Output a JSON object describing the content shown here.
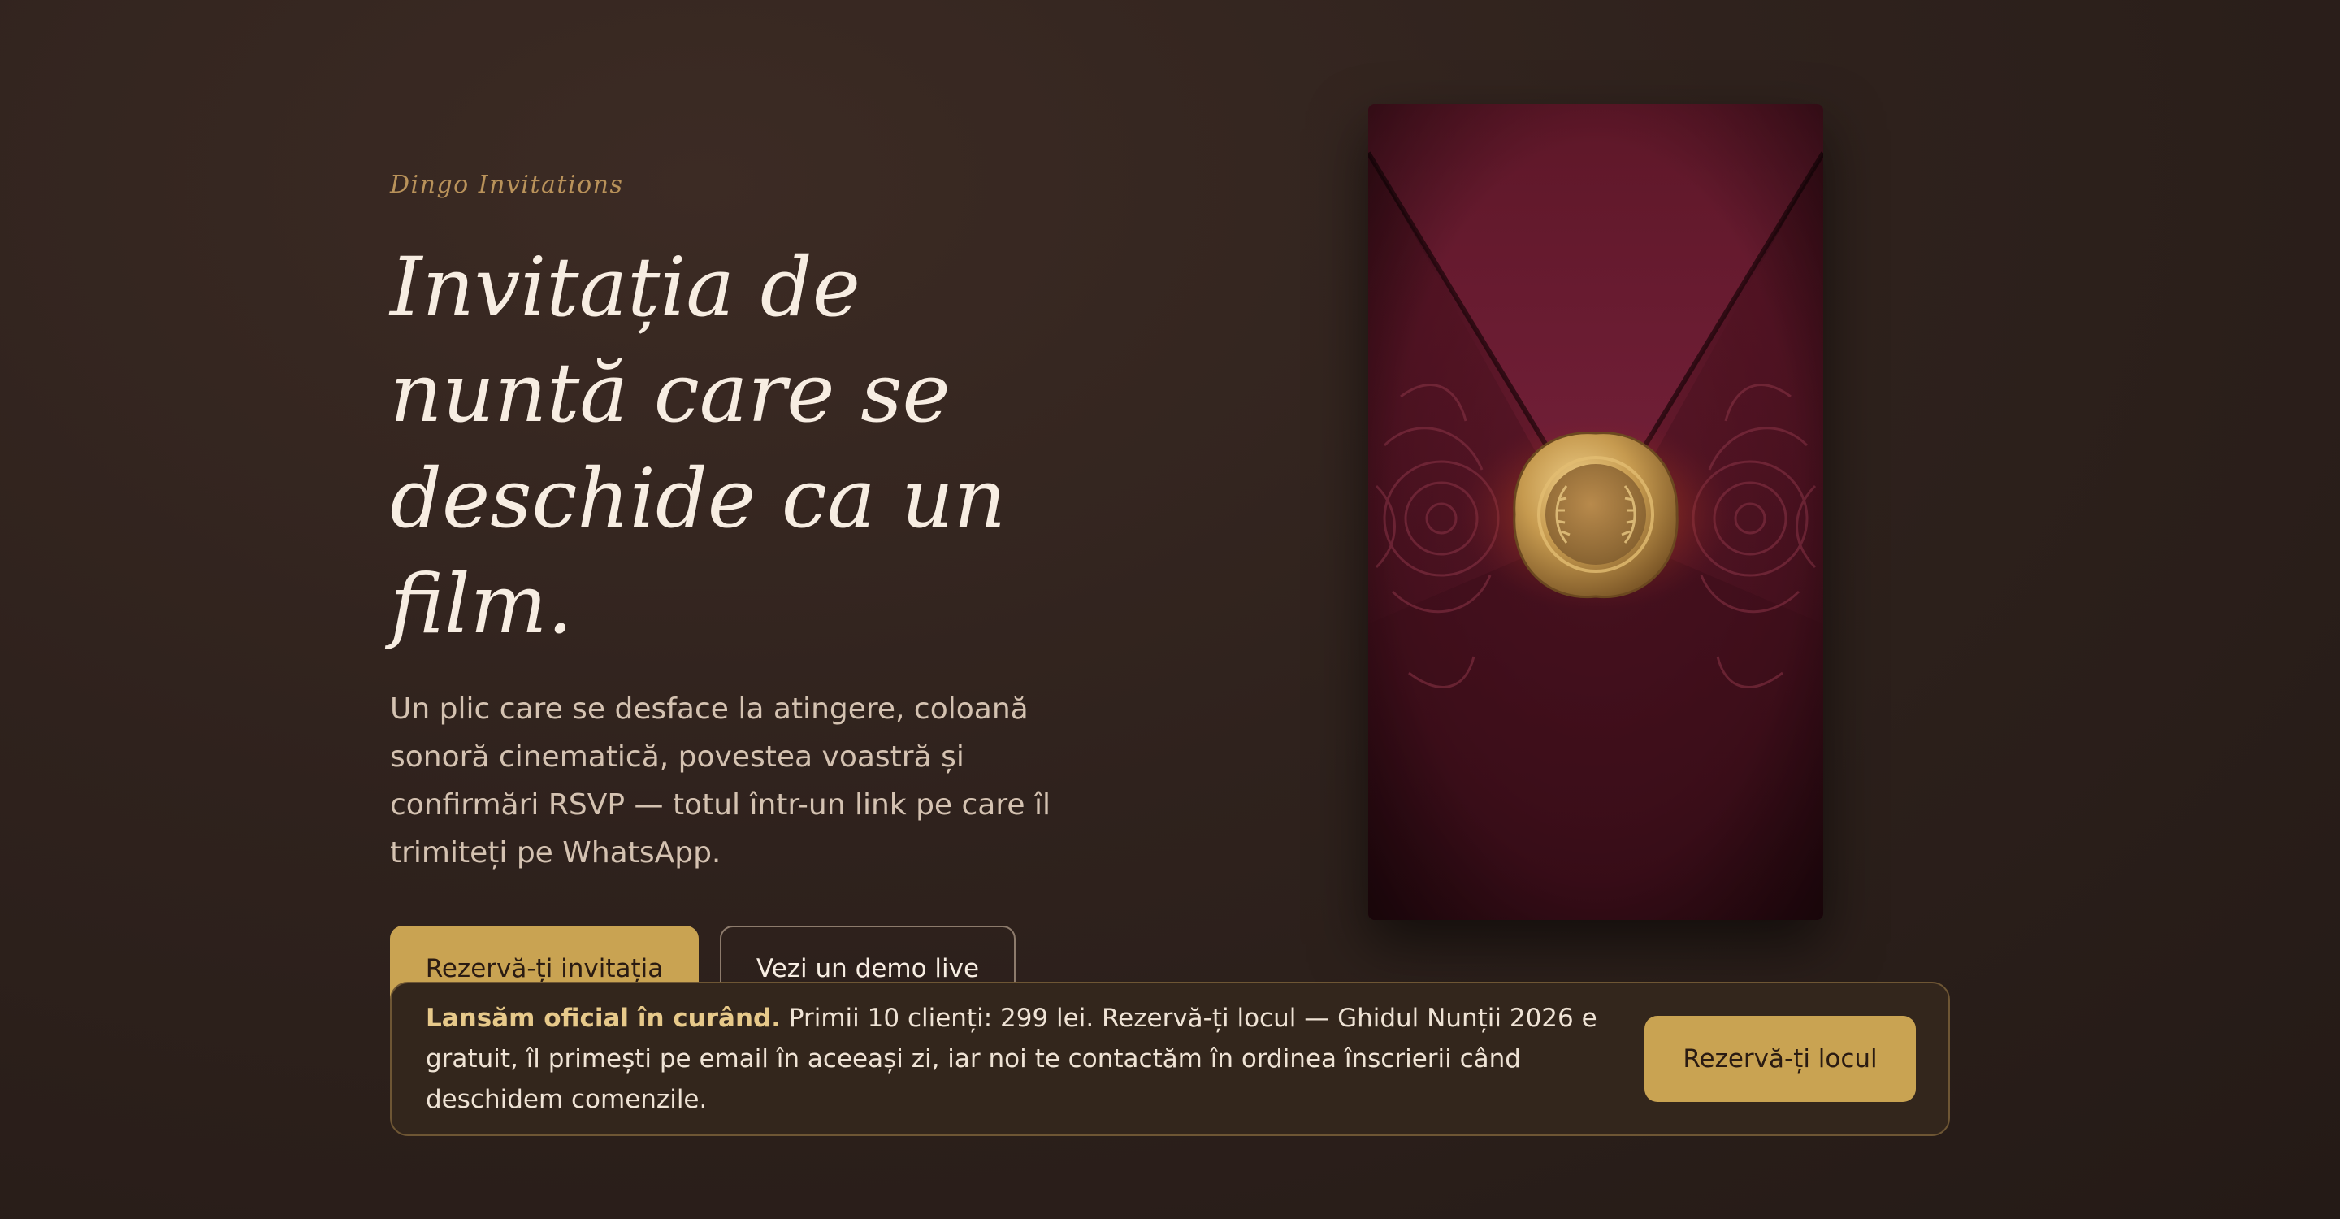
{
  "hero": {
    "brand": "Dingo Invitations",
    "headline": "Invitația de nuntă care se deschide ca un film.",
    "lead": "Un plic care se desface la atingere, coloană sonoră cinematică, povestea voastră și confirmări RSVP — totul într-un link pe care îl trimiteți pe WhatsApp.",
    "primary_cta": "Rezervă-ți invitația",
    "secondary_cta": "Vezi un demo live"
  },
  "banner": {
    "highlight": "Lansăm oficial în curând.",
    "text": " Primii 10 clienți: 299 lei. Rezervă-ți locul — Ghidul Nunții 2026 e gratuit, îl primești pe email în aceeași zi, iar noi te contactăm în ordinea înscrierii când deschidem comenzile.",
    "cta": "Rezervă-ți locul"
  },
  "colors": {
    "accent_gold": "#c9a352",
    "background": "#2f221d",
    "envelope_burgundy": "#6a1a2c"
  }
}
